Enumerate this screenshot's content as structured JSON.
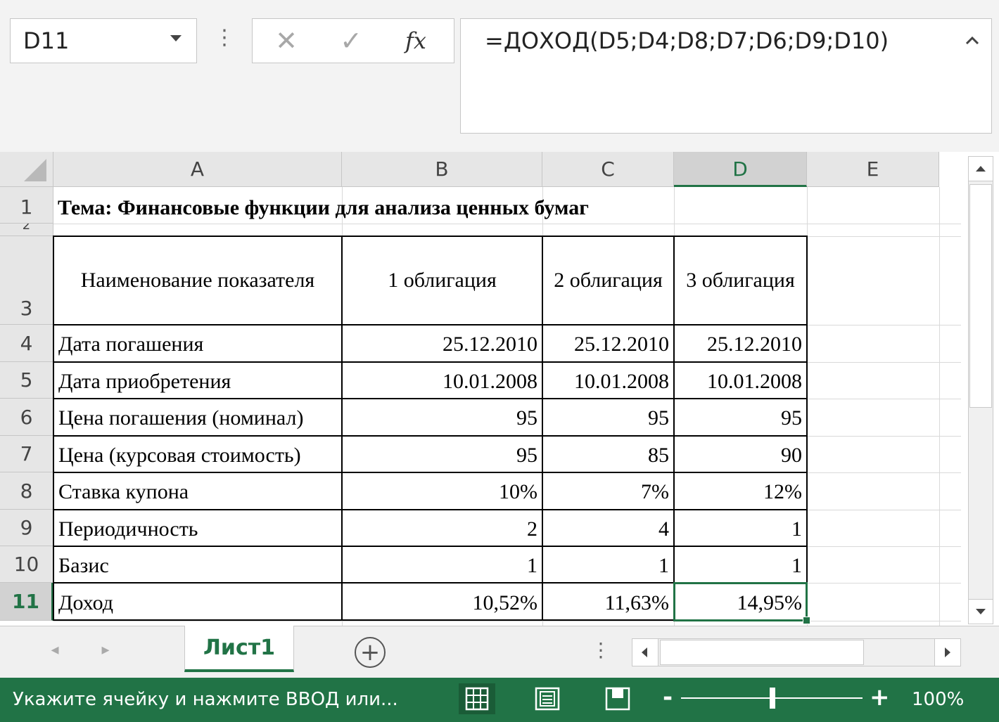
{
  "name_box": "D11",
  "formula_bar": {
    "more_glyph": "⋮",
    "cancel_glyph": "✕",
    "enter_glyph": "✓",
    "fx_label": "fx",
    "formula": "=ДОХОД(D5;D4;D8;D7;D6;D9;D10)"
  },
  "columns": [
    "A",
    "B",
    "C",
    "D",
    "E"
  ],
  "selected_column": "D",
  "rows": [
    "1",
    "2",
    "3",
    "4",
    "5",
    "6",
    "7",
    "8",
    "9",
    "10",
    "11"
  ],
  "selected_row": "11",
  "sheet": {
    "title": "Тема: Финансовые функции для анализа ценных бумаг",
    "header": [
      "Наименование показателя",
      "1 облигация",
      "2 облигация",
      "3 облигация"
    ],
    "data": [
      [
        "Дата погашения",
        "25.12.2010",
        "25.12.2010",
        "25.12.2010"
      ],
      [
        "Дата приобретения",
        "10.01.2008",
        "10.01.2008",
        "10.01.2008"
      ],
      [
        "Цена погашения (номинал)",
        "95",
        "95",
        "95"
      ],
      [
        "Цена (курсовая стоимость)",
        "95",
        "85",
        "90"
      ],
      [
        "Ставка купона",
        "10%",
        "7%",
        "12%"
      ],
      [
        "Периодичность",
        "2",
        "4",
        "1"
      ],
      [
        "Базис",
        "1",
        "1",
        "1"
      ],
      [
        "Доход",
        "10,52%",
        "11,63%",
        "14,95%"
      ]
    ]
  },
  "tabs": {
    "prev_glyph": "◂",
    "next_glyph": "▸",
    "active": "Лист1",
    "add_glyph": "+",
    "dots_glyph": "⋮"
  },
  "status": {
    "message": "Укажите ячейку и нажмите ВВОД или...",
    "zoom_minus": "-",
    "zoom_plus": "+",
    "zoom": "100%"
  },
  "colors": {
    "accent": "#217346",
    "header_bg": "#e6e6e6",
    "gridline": "#d9d9d9"
  }
}
